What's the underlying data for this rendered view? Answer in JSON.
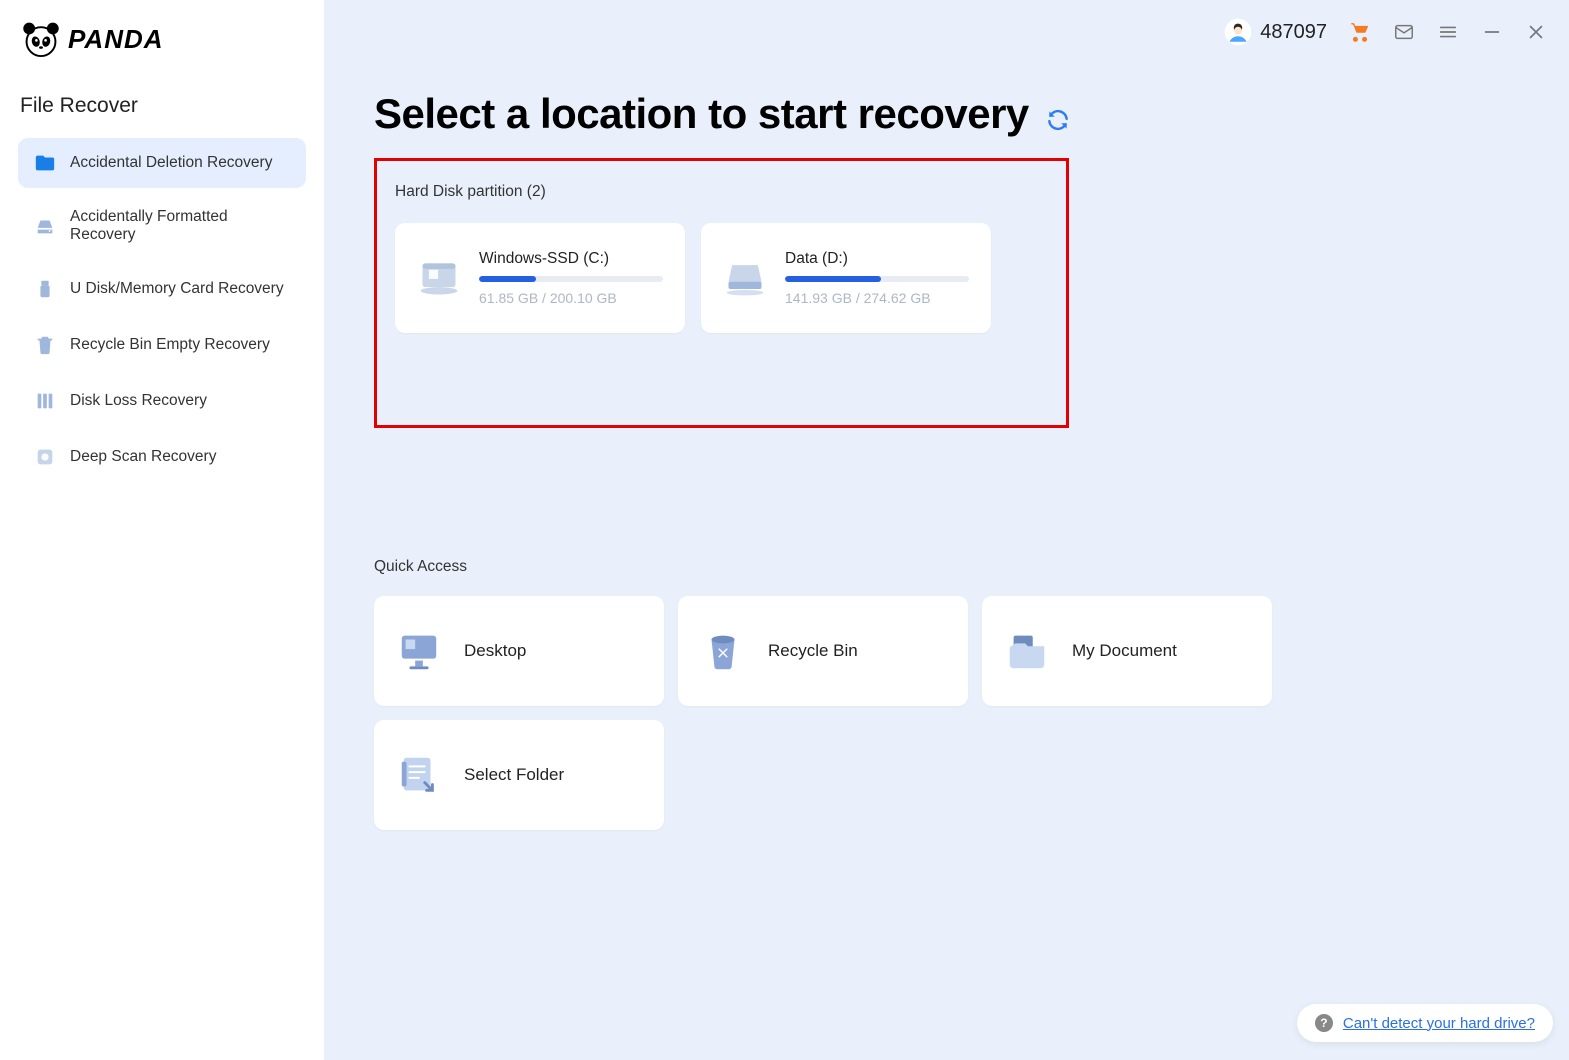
{
  "brand": "PANDA",
  "sidebar": {
    "title": "File Recover",
    "items": [
      {
        "label": "Accidental Deletion Recovery",
        "icon": "folder-icon",
        "active": true
      },
      {
        "label": "Accidentally Formatted Recovery",
        "icon": "drive-icon",
        "active": false
      },
      {
        "label": "U Disk/Memory Card Recovery",
        "icon": "usb-icon",
        "active": false
      },
      {
        "label": "Recycle Bin Empty Recovery",
        "icon": "bin-icon",
        "active": false
      },
      {
        "label": "Disk Loss Recovery",
        "icon": "disks-icon",
        "active": false
      },
      {
        "label": "Deep Scan Recovery",
        "icon": "scan-icon",
        "active": false
      }
    ]
  },
  "header": {
    "user_id": "487097"
  },
  "main": {
    "title": "Select a location to start recovery",
    "partitions_label": "Hard Disk partition   (2)",
    "partitions": [
      {
        "name": "Windows-SSD   (C:)",
        "used": "61.85 GB",
        "total": "200.10 GB",
        "size_text": "61.85 GB / 200.10 GB",
        "fill_pct": 31
      },
      {
        "name": "Data   (D:)",
        "used": "141.93 GB",
        "total": "274.62 GB",
        "size_text": "141.93 GB / 274.62 GB",
        "fill_pct": 52
      }
    ],
    "quick_access_label": "Quick Access",
    "quick_access": [
      {
        "label": "Desktop",
        "icon": "desktop-icon"
      },
      {
        "label": "Recycle Bin",
        "icon": "recycle-bin-icon"
      },
      {
        "label": "My Document",
        "icon": "document-folder-icon"
      },
      {
        "label": "Select Folder",
        "icon": "select-folder-icon"
      }
    ]
  },
  "help_link": "Can't detect your hard drive?"
}
